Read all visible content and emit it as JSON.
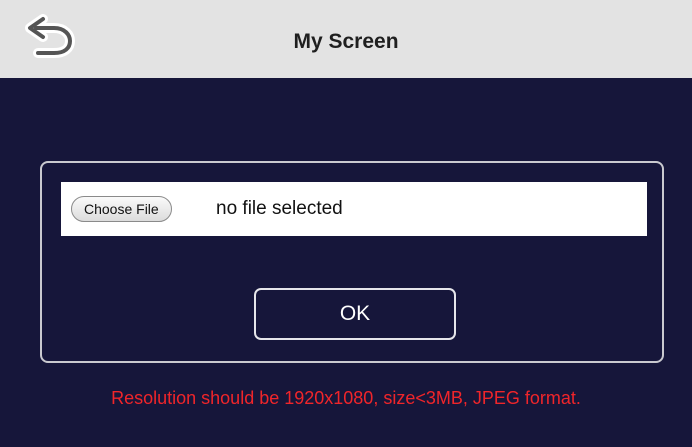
{
  "header": {
    "title": "My Screen",
    "back_icon": "back-arrow-icon"
  },
  "upload": {
    "choose_file_label": "Choose File",
    "file_status": "no file selected"
  },
  "actions": {
    "ok_label": "OK"
  },
  "note": {
    "text": "Resolution should be 1920x1080, size<3MB, JPEG format."
  },
  "colors": {
    "header_bg": "#e3e3e3",
    "content_bg": "#16163a",
    "warning_text": "#f0252a",
    "button_border": "#e6e6ea"
  }
}
